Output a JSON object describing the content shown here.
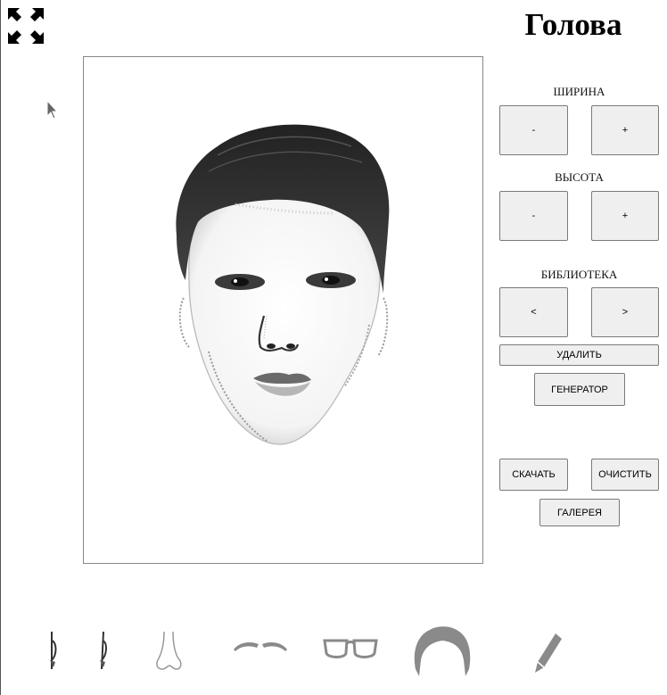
{
  "header": {
    "title": "Голова"
  },
  "icons": {
    "fullscreen": "fullscreen-icon",
    "cursor": "mouse-cursor-icon",
    "ear": "ear-icon",
    "nose": "nose-icon",
    "eyebrows": "eyebrows-icon",
    "glasses": "glasses-icon",
    "hair": "hair-icon",
    "pencil": "pencil-icon"
  },
  "controls": {
    "width": {
      "label": "ШИРИНА",
      "minus": "-",
      "plus": "+"
    },
    "height": {
      "label": "ВЫСОТА",
      "minus": "-",
      "plus": "+"
    },
    "library": {
      "label": "БИБЛИОТЕКА",
      "prev": "<",
      "next": ">"
    },
    "delete_label": "УДАЛИТЬ",
    "generator_label": "ГЕНЕРАТОР",
    "download_label": "СКАЧАТЬ",
    "clear_label": "ОЧИСТИТЬ",
    "gallery_label": "ГАЛЕРЕЯ"
  },
  "colors": {
    "button_bg": "#efefef",
    "button_border": "#7a7a7a",
    "icon_gray": "#8a8a8a"
  }
}
